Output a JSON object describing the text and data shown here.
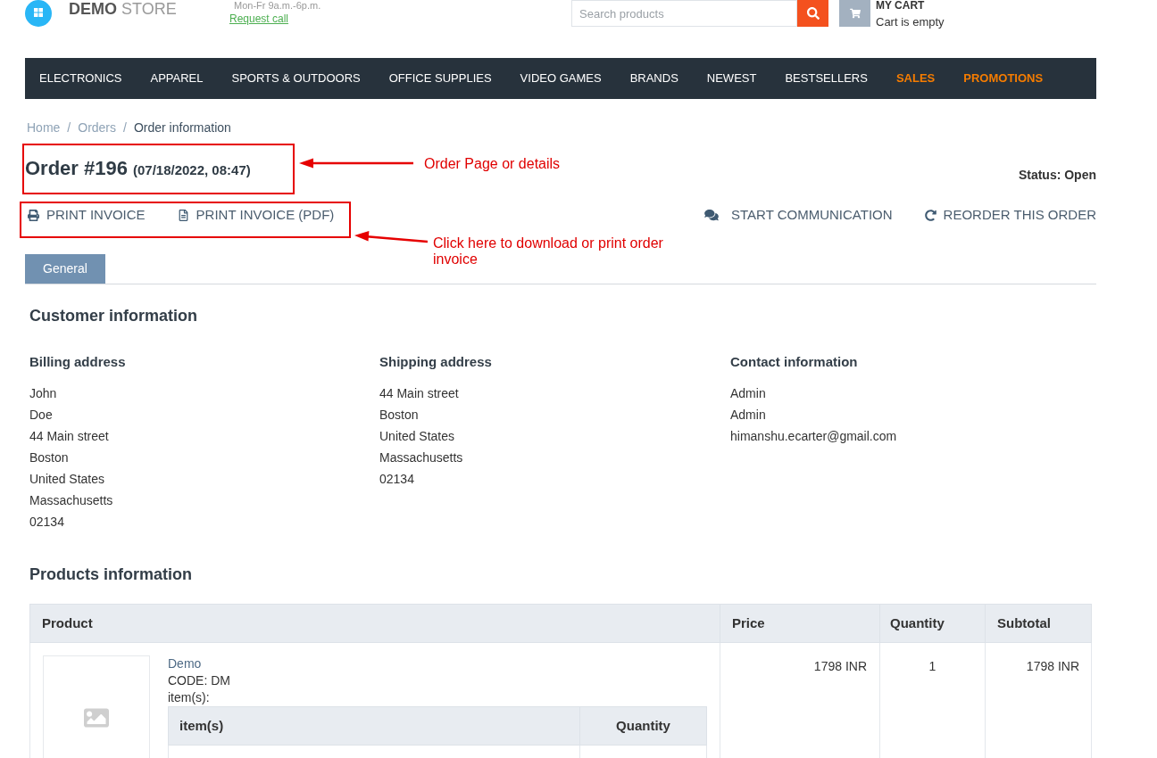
{
  "header": {
    "logo": "**DEMO** STORE",
    "hours": "Mon-Fr 9a.m.-6p.m.",
    "request_call": "Request call",
    "search": {
      "placeholder": "Search products"
    },
    "cart": {
      "title": "MY CART",
      "status": "Cart is empty"
    }
  },
  "nav": [
    {
      "label": "ELECTRONICS",
      "highlighted": false
    },
    {
      "label": "APPAREL",
      "highlighted": false
    },
    {
      "label": "SPORTS & OUTDOORS",
      "highlighted": false
    },
    {
      "label": "OFFICE SUPPLIES",
      "highlighted": false
    },
    {
      "label": "VIDEO GAMES",
      "highlighted": false
    },
    {
      "label": "BRANDS",
      "highlighted": false
    },
    {
      "label": "NEWEST",
      "highlighted": false
    },
    {
      "label": "BESTSELLERS",
      "highlighted": false
    },
    {
      "label": "SALES",
      "highlighted": true
    },
    {
      "label": "PROMOTIONS",
      "highlighted": true
    }
  ],
  "breadcrumb": [
    {
      "kind": "link",
      "text": "Home"
    },
    {
      "kind": "separator",
      "text": "/"
    },
    {
      "kind": "link",
      "text": "Orders"
    },
    {
      "kind": "separator",
      "text": "/"
    },
    {
      "kind": "current",
      "text": "Order information"
    }
  ],
  "order": {
    "title": "Order #196",
    "date": "(07/18/2022, 08:47)",
    "status": "Status: Open"
  },
  "left_actions": [
    {
      "kind": "print",
      "label": "PRINT INVOICE"
    },
    {
      "kind": "pdf",
      "label": "PRINT INVOICE (PDF)"
    }
  ],
  "right_actions": [
    {
      "kind": "chat",
      "label": "START COMMUNICATION"
    },
    {
      "kind": "reorder",
      "label": "REORDER THIS ORDER"
    }
  ],
  "tabs": [
    {
      "label": "General",
      "selected": true
    }
  ],
  "customer_information": {
    "title": "Customer information",
    "columns": [
      {
        "heading": "Billing address",
        "lines": [
          "John",
          "Doe",
          "44 Main street",
          "Boston",
          "United States",
          "Massachusetts",
          "02134"
        ]
      },
      {
        "heading": "Shipping address",
        "lines": [
          "44 Main street",
          "Boston",
          "United States",
          "Massachusetts",
          "02134"
        ]
      },
      {
        "heading": "Contact information",
        "lines": [
          "Admin",
          "Admin",
          "himanshu.ecarter@gmail.com"
        ]
      }
    ]
  },
  "products_information": {
    "title": "Products information",
    "table": {
      "columns": [
        "Product",
        "Price",
        "Quantity",
        "Subtotal"
      ],
      "rows": [
        {
          "name": "Demo",
          "code": "CODE: DM",
          "items_label": "item(s):",
          "items_table": {
            "columns": [
              "item(s)",
              "Quantity"
            ]
          },
          "price": "1798 INR",
          "quantity": "1",
          "subtotal": "1798 INR"
        }
      ]
    }
  },
  "annotations": [
    {
      "text": "Order Page or details"
    },
    {
      "text": "Click here to download or print order invoice"
    }
  ]
}
